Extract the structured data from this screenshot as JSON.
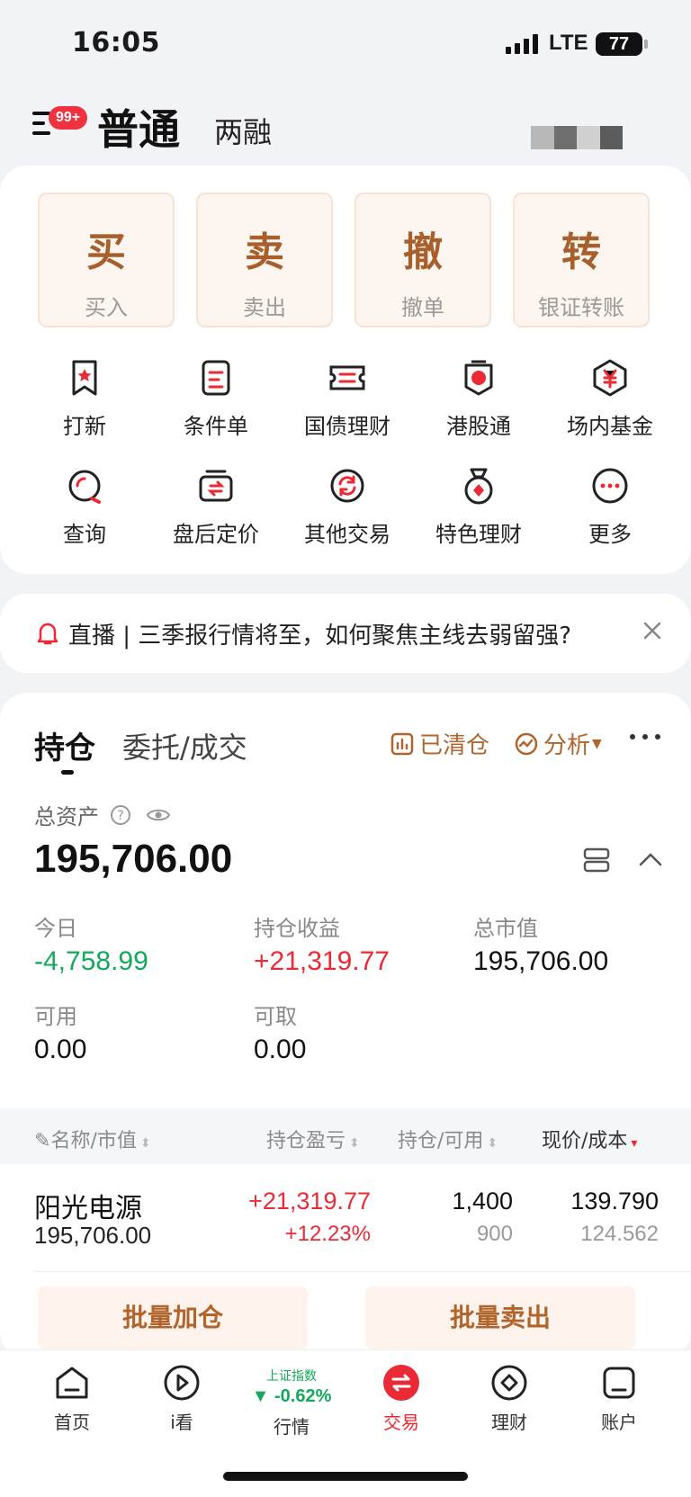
{
  "status_bar": {
    "time": "16:05",
    "network": "LTE",
    "battery": "77"
  },
  "header": {
    "badge": "99+",
    "tab_active": "普通",
    "tab_inactive": "两融"
  },
  "quick_actions": [
    {
      "char": "买",
      "label": "买入"
    },
    {
      "char": "卖",
      "label": "卖出"
    },
    {
      "char": "撤",
      "label": "撤单"
    },
    {
      "char": "转",
      "label": "银证转账"
    }
  ],
  "grid_menu": [
    {
      "label": "打新",
      "icon": "ipo-icon"
    },
    {
      "label": "条件单",
      "icon": "conditional-order-icon"
    },
    {
      "label": "国债理财",
      "icon": "bond-icon"
    },
    {
      "label": "港股通",
      "icon": "hk-connect-icon"
    },
    {
      "label": "场内基金",
      "icon": "yen-fund-icon"
    },
    {
      "label": "查询",
      "icon": "search-icon"
    },
    {
      "label": "盘后定价",
      "icon": "after-hours-icon"
    },
    {
      "label": "其他交易",
      "icon": "refresh-icon"
    },
    {
      "label": "特色理财",
      "icon": "medal-icon"
    },
    {
      "label": "更多",
      "icon": "more-icon"
    }
  ],
  "banner": {
    "text": "直播 | 三季报行情将至，如何聚焦主线去弱留强?"
  },
  "holdings": {
    "tab_active": "持仓",
    "tab_inactive": "委托/成交",
    "cleared": "已清仓",
    "analysis": "分析",
    "total_asset_label": "总资产",
    "total_asset": "195,706.00",
    "stats": {
      "today_label": "今日",
      "today": "-4,758.99",
      "pnl_label": "持仓收益",
      "pnl": "+21,319.77",
      "mv_label": "总市值",
      "mv": "195,706.00",
      "avail_label": "可用",
      "avail": "0.00",
      "withdraw_label": "可取",
      "withdraw": "0.00"
    },
    "columns": [
      "名称/市值",
      "持仓盈亏",
      "持仓/可用",
      "现价/成本"
    ],
    "rows": [
      {
        "name": "阳光电源",
        "market_value": "195,706.00",
        "pnl": "+21,319.77",
        "pnl_pct": "+12.23%",
        "position": "1,400",
        "available": "900",
        "price": "139.790",
        "cost": "124.562"
      }
    ],
    "batch_add": "批量加仓",
    "batch_sell": "批量卖出"
  },
  "nav": {
    "items": [
      "首页",
      "i看",
      "行情",
      "交易",
      "理财",
      "账户"
    ],
    "index_name": "上证指数",
    "index_change": "▼ -0.62%"
  },
  "colors": {
    "accent": "#ea2a35",
    "brown": "#a7602b",
    "up": "#ea2a35",
    "down": "#14a85c"
  }
}
